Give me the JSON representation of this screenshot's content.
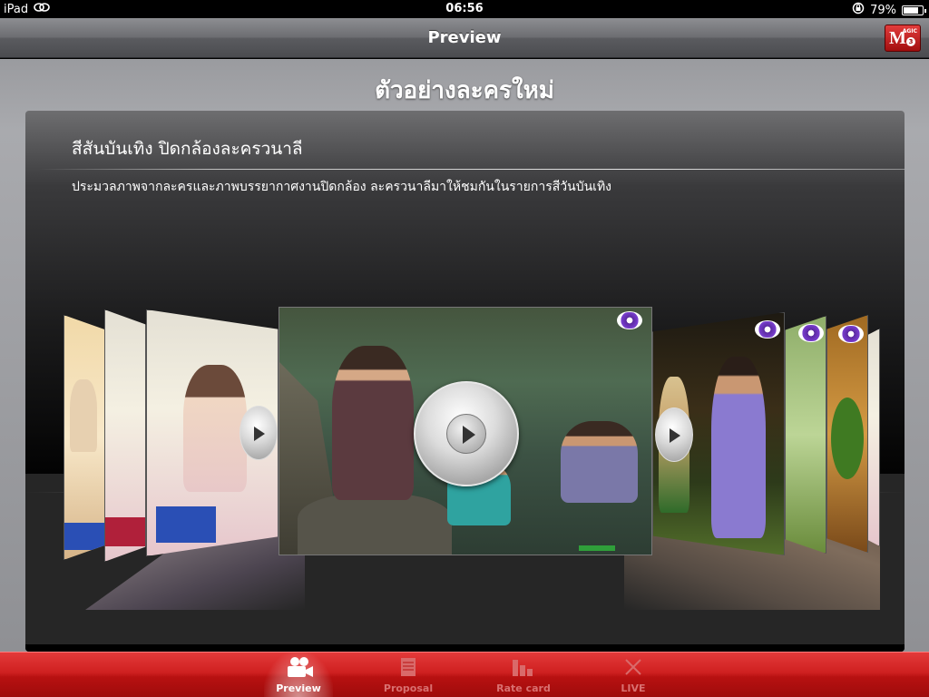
{
  "status_bar": {
    "device": "iPad",
    "time": "06:56",
    "battery": "79%",
    "battery_level": 0.79
  },
  "nav": {
    "title": "Preview",
    "magic_button": {
      "letter": "M",
      "small_text": "AGIC",
      "badge": "3"
    }
  },
  "page": {
    "section_title": "ตัวอย่างละครใหม่",
    "item_title": "สีสันบันเทิง ปิดกล้องละครวนาลี",
    "item_description": "ประมวลภาพจากละครและภาพบรรยากาศงานปิดกล้อง ละครวนาลีมาให้ชมกันในรายการสีวันบันเทิง"
  },
  "carousel": {
    "selected_index": 3,
    "item_count": 7,
    "icons": [
      "play-icon"
    ]
  },
  "tabs": [
    {
      "label": "Preview",
      "icon": "video-camera-icon",
      "active": true
    },
    {
      "label": "Proposal",
      "icon": "document-icon",
      "active": false
    },
    {
      "label": "Rate card",
      "icon": "bar-chart-icon",
      "active": false
    },
    {
      "label": "LIVE",
      "icon": "live-broadcast-icon",
      "active": false
    }
  ],
  "colors": {
    "tabbar_red": "#cf2020",
    "nav_grey": "#6d6e72",
    "accent_purple": "#7a3fd0"
  }
}
